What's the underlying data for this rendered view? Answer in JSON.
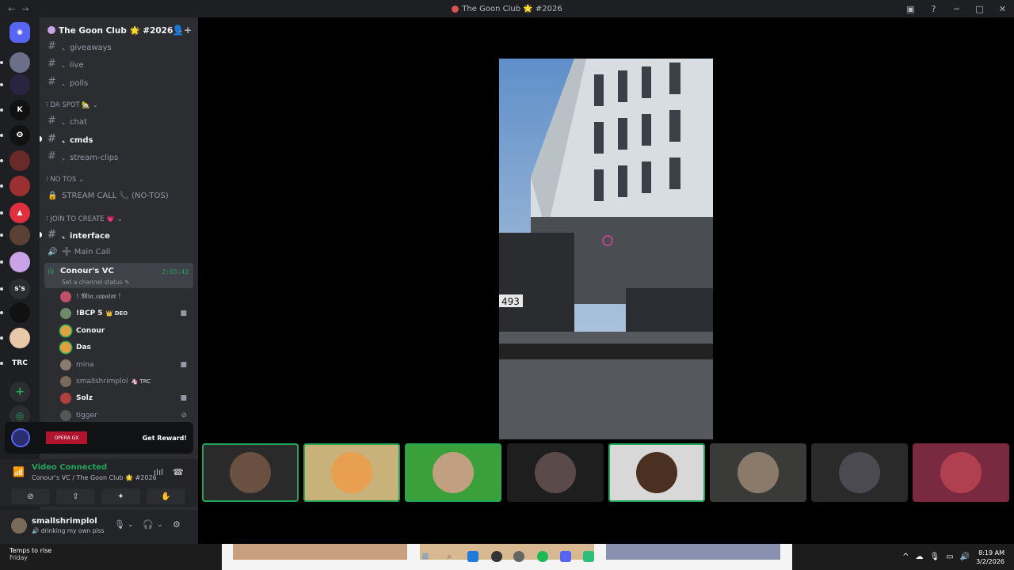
{
  "titlebar": {
    "title": "The Goon Club 🌟 #2026",
    "back_glyph": "←",
    "forward_glyph": "→",
    "inbox_glyph": "▣",
    "help_glyph": "?",
    "minimize_glyph": "─",
    "maximize_glyph": "□",
    "close_glyph": "✕"
  },
  "guild": {
    "name": "The Goon Club 🌟 #2026",
    "chevron": "⌄",
    "invite_glyph": "👤+"
  },
  "channels": [
    {
      "name": "、giveaways",
      "type": "text",
      "bold": false
    },
    {
      "name": "、live",
      "type": "text",
      "bold": false
    },
    {
      "name": "、polls",
      "type": "text",
      "bold": false
    },
    {
      "name": "、chat",
      "type": "text",
      "bold": false
    },
    {
      "name": "、cmds",
      "type": "text",
      "bold": true
    },
    {
      "name": "、stream-clips",
      "type": "text",
      "bold": false
    },
    {
      "name": "STREAM CALL 📞 (NO-TOS)",
      "type": "locked",
      "bold": false
    },
    {
      "name": "、interface",
      "type": "text",
      "bold": true
    },
    {
      "name": "➕ Main Call",
      "type": "voice",
      "bold": false
    }
  ],
  "categories": [
    {
      "label": "⁝ DA SPOT 🏡 ⌄"
    },
    {
      "label": "⁝ NO TOS ⌄"
    },
    {
      "label": "⁝ JOIN TO CREATE 💗 ⌄"
    }
  ],
  "active_vc": {
    "name": "Conour's VC",
    "status": "Set a channel status ✎",
    "timer": "2:03:43"
  },
  "members": [
    {
      "name": "! 𝕸𝖎𝖆.𝖈𝖔𝖕𝖆𝖑𝖔𝖙 !",
      "tag": "",
      "camera": false,
      "speaking": false,
      "bold": false,
      "color": "#c0506a"
    },
    {
      "name": "!BCP 5",
      "tag": "👑 DEO",
      "camera": true,
      "speaking": false,
      "bold": true,
      "color": "#6d8a6a"
    },
    {
      "name": "Conour",
      "tag": "",
      "camera": false,
      "speaking": true,
      "bold": true,
      "color": "#d9a441"
    },
    {
      "name": "Das",
      "tag": "",
      "camera": false,
      "speaking": true,
      "bold": true,
      "color": "#e0a040"
    },
    {
      "name": "mina",
      "tag": "",
      "camera": true,
      "speaking": false,
      "bold": false,
      "color": "#8a7a70"
    },
    {
      "name": "smallshrimplol",
      "tag": "🦄 TRC",
      "camera": false,
      "speaking": false,
      "bold": false,
      "color": "#7a6a5a"
    },
    {
      "name": "Solz",
      "tag": "",
      "camera": true,
      "speaking": false,
      "bold": true,
      "color": "#b04040"
    },
    {
      "name": "tigger",
      "tag": "",
      "camera": false,
      "speaking": false,
      "bold": false,
      "color": "#555"
    }
  ],
  "icons": {
    "hash": "#",
    "lock": "🔒",
    "speaker": "🔊",
    "camera": "■",
    "deafened": "⊘",
    "add_server": "+",
    "explore": "◎"
  },
  "promo": {
    "ad_label": "OPERA GX",
    "button": "Get Reward!"
  },
  "voice": {
    "status": "Video Connected",
    "channel": "Conour's VC / The Goon Club 🌟 #2026",
    "signal_glyph": "📶",
    "soundboard_glyph": "ılıl",
    "disconnect_glyph": "☎",
    "buttons": [
      "⊘",
      "⇪",
      "✦",
      "✋"
    ]
  },
  "user": {
    "name": "smallshrimplol",
    "status": "🔊 drinking my own piss",
    "mic": "🎙",
    "headset": "🎧",
    "settings": "⚙",
    "chevron": "⌄"
  },
  "servers": [
    {
      "label": "",
      "color": "#5865f2",
      "glyph": "◉"
    },
    {
      "label": "",
      "color": "#6b6f88",
      "glyph": ""
    },
    {
      "label": "",
      "color": "#2a2440",
      "glyph": ""
    },
    {
      "label": "",
      "color": "#111",
      "glyph": "K"
    },
    {
      "label": "",
      "color": "#111",
      "glyph": "ⵙ"
    },
    {
      "label": "",
      "color": "#6a2a2a",
      "glyph": ""
    },
    {
      "label": "",
      "color": "#9c3030",
      "glyph": ""
    },
    {
      "label": "",
      "color": "#e03040",
      "glyph": "▲"
    },
    {
      "label": "",
      "color": "#5a4035",
      "glyph": ""
    },
    {
      "label": "",
      "color": "#c9a3e6",
      "glyph": ""
    },
    {
      "label": "s's",
      "color": "#2b2d31",
      "glyph": ""
    },
    {
      "label": "",
      "color": "#111",
      "glyph": ""
    },
    {
      "label": "",
      "color": "#e8c8a8",
      "glyph": ""
    },
    {
      "label": "TRC",
      "color": "#1e1f22",
      "glyph": ""
    }
  ],
  "tiles": [
    {
      "name": "tile-1",
      "speaking": true,
      "bg": "#2a2a2a",
      "face": "#6a5040"
    },
    {
      "name": "tile-2",
      "speaking": true,
      "bg": "#c8b27a",
      "face": "#e8a050"
    },
    {
      "name": "tile-3",
      "speaking": true,
      "bg": "#3aa03a",
      "face": "#c0a080"
    },
    {
      "name": "tile-4",
      "speaking": false,
      "bg": "#1e1e1e",
      "face": "#5a4a4a"
    },
    {
      "name": "tile-5",
      "speaking": true,
      "bg": "#d8d8d8",
      "face": "#4a3020"
    },
    {
      "name": "tile-6",
      "speaking": false,
      "bg": "#3a3a38",
      "face": "#8a7a6a"
    },
    {
      "name": "tile-7",
      "speaking": false,
      "bg": "#2a2a2a",
      "face": "#4a4a50"
    },
    {
      "name": "tile-8",
      "speaking": false,
      "bg": "#7a2a40",
      "face": "#b04050"
    }
  ],
  "taskbar": {
    "weather_title": "Temps to rise",
    "weather_sub": "Friday",
    "time": "8:19 AM",
    "date": "3/2/2026",
    "start_glyph": "⊞",
    "search_glyph": "⌕",
    "tray_glyphs": [
      "^",
      "☁",
      "🎙",
      "▭",
      "🔊"
    ]
  },
  "colors": {
    "accent_green": "#23a55a",
    "sidebar_bg": "#2b2d31",
    "app_bg": "#1e1f22"
  }
}
